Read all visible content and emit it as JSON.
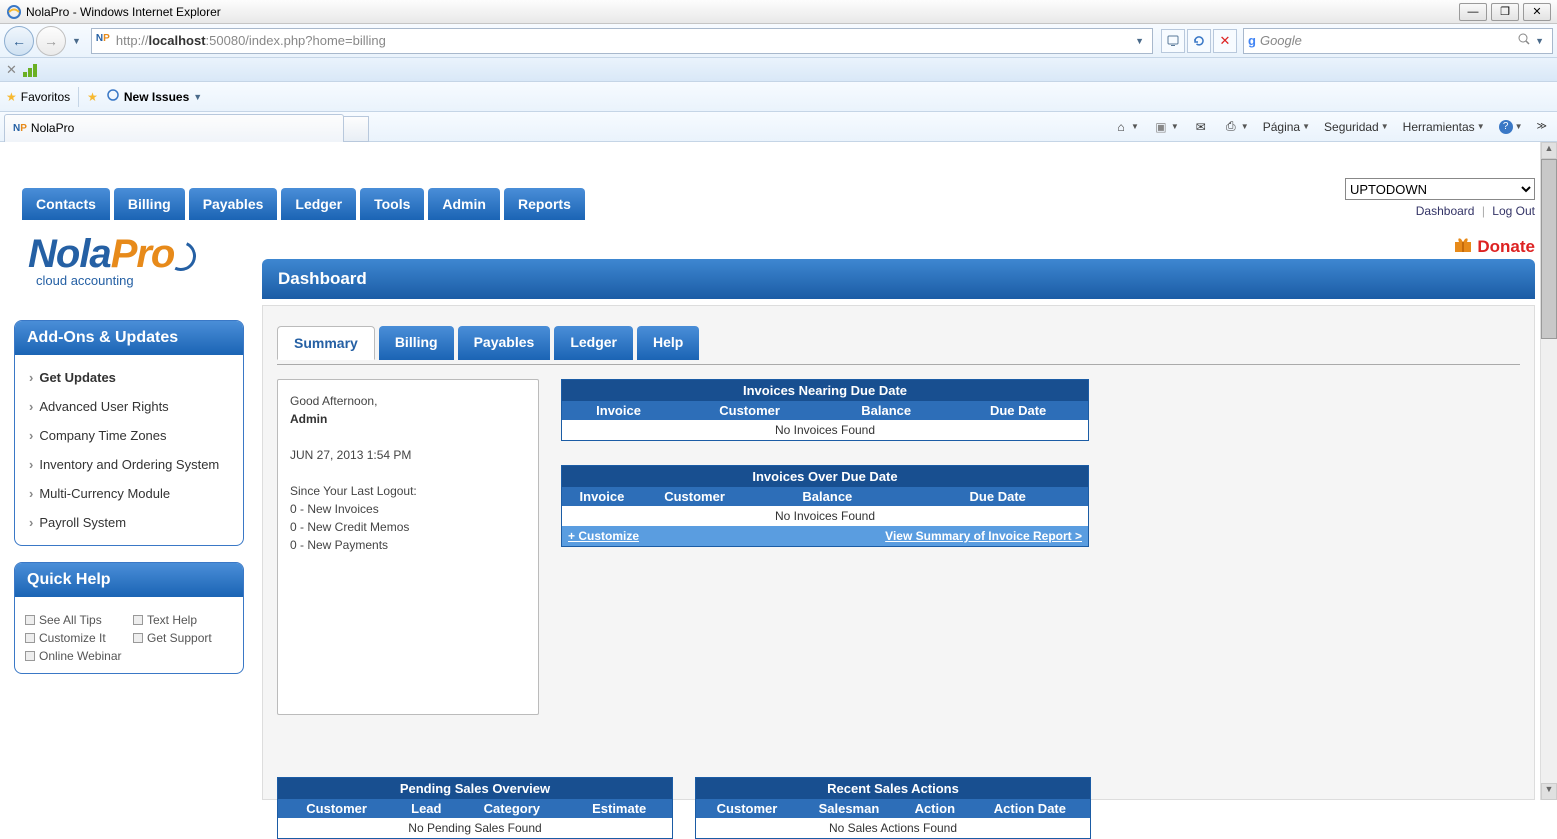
{
  "window": {
    "title": "NolaPro - Windows Internet Explorer",
    "url_pre": "http://",
    "url_host": "localhost",
    "url_post": ":50080/index.php?home=billing",
    "search_engine": "Google",
    "favorites_label": "Favoritos",
    "new_issues_label": "New Issues",
    "page_tab_title": "NolaPro",
    "cmd_page": "Página",
    "cmd_security": "Seguridad",
    "cmd_tools": "Herramientas",
    "min": "—",
    "max": "□",
    "close": "✕",
    "controls": {
      "minimize": "_",
      "maximize": "❐",
      "close": "✕"
    }
  },
  "app": {
    "company_selected": "UPTODOWN",
    "dashboard_link": "Dashboard",
    "logout_link": "Log Out",
    "donate": "Donate",
    "logo_main": "Nola",
    "logo_accent": "Pro",
    "logo_sub": "cloud accounting",
    "dash_title": "Dashboard",
    "main_nav": [
      "Contacts",
      "Billing",
      "Payables",
      "Ledger",
      "Tools",
      "Admin",
      "Reports"
    ],
    "sub_tabs": [
      "Summary",
      "Billing",
      "Payables",
      "Ledger",
      "Help"
    ]
  },
  "info": {
    "greeting": "Good Afternoon,",
    "user": "Admin",
    "timestamp": "JUN 27, 2013 1:54 PM",
    "since": "Since Your Last Logout:",
    "line1": "0 - New Invoices",
    "line2": "0 - New Credit Memos",
    "line3": "0 - New Payments"
  },
  "nearing": {
    "title": "Invoices Nearing Due Date",
    "cols": [
      "Invoice",
      "Customer",
      "Balance",
      "Due Date"
    ],
    "empty": "No Invoices Found"
  },
  "overdue": {
    "title": "Invoices Over Due Date",
    "cols": [
      "Invoice",
      "Customer",
      "Balance",
      "Due Date"
    ],
    "empty": "No Invoices Found",
    "customize": "+ Customize",
    "view_summary": "View Summary of Invoice Report >"
  },
  "pending": {
    "title": "Pending Sales Overview",
    "cols": [
      "Customer",
      "Lead",
      "Category",
      "Estimate"
    ],
    "empty": "No Pending Sales Found"
  },
  "recent": {
    "title": "Recent Sales Actions",
    "cols": [
      "Customer",
      "Salesman",
      "Action",
      "Action Date"
    ],
    "empty": "No Sales Actions Found"
  },
  "sidebar": {
    "addons_title": "Add-Ons & Updates",
    "addons_items": [
      "Get Updates",
      "Advanced User Rights",
      "Company Time Zones",
      "Inventory and Ordering System",
      "Multi-Currency Module",
      "Payroll System"
    ],
    "help_title": "Quick Help",
    "help_items": [
      "See All Tips",
      "Text Help",
      "Customize It",
      "Get Support",
      "Online Webinar"
    ]
  }
}
